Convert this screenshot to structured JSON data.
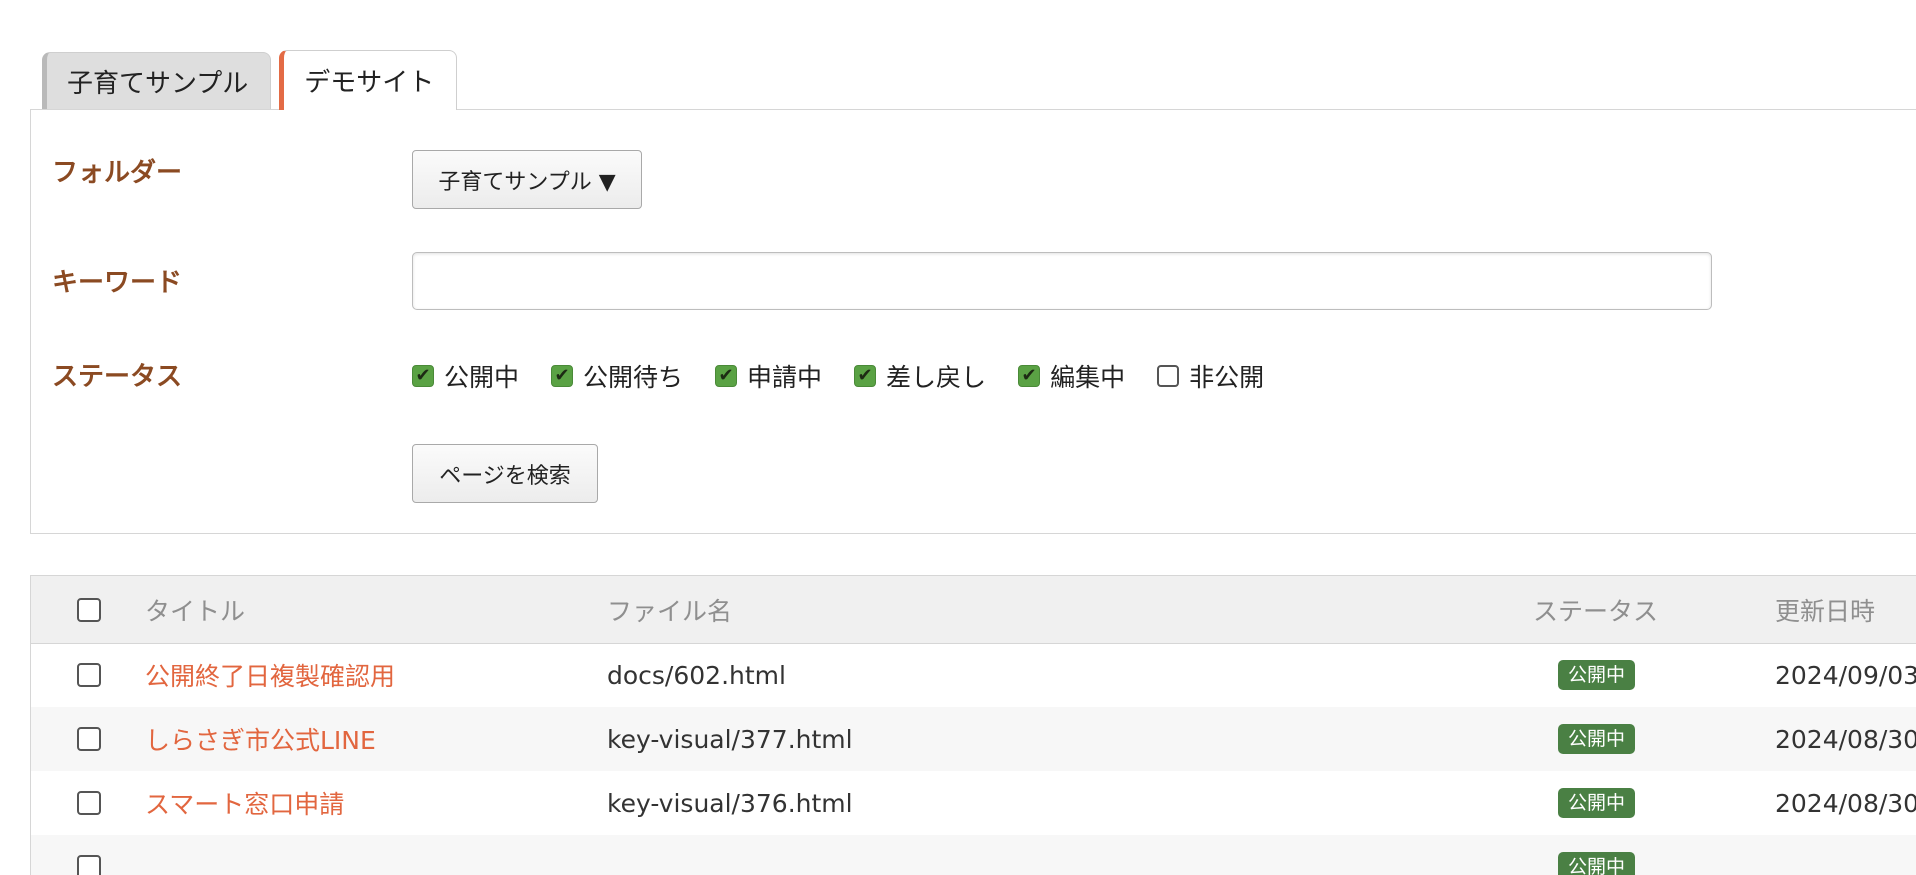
{
  "tabs": [
    {
      "label": "子育てサンプル",
      "active": false
    },
    {
      "label": "デモサイト",
      "active": true
    }
  ],
  "search": {
    "folder_label": "フォルダー",
    "folder_value": "子育てサンプル ▼",
    "keyword_label": "キーワード",
    "keyword_value": "",
    "keyword_placeholder": "",
    "status_label": "ステータス",
    "statuses": [
      {
        "label": "公開中",
        "checked": true
      },
      {
        "label": "公開待ち",
        "checked": true
      },
      {
        "label": "申請中",
        "checked": true
      },
      {
        "label": "差し戻し",
        "checked": true
      },
      {
        "label": "編集中",
        "checked": true
      },
      {
        "label": "非公開",
        "checked": false
      }
    ],
    "search_button": "ページを検索"
  },
  "table": {
    "headers": {
      "title": "タイトル",
      "filename": "ファイル名",
      "status": "ステータス",
      "updated": "更新日時"
    },
    "rows": [
      {
        "title": "公開終了日複製確認用",
        "filename": "docs/602.html",
        "status": "公開中",
        "updated": "2024/09/03"
      },
      {
        "title": "しらさぎ市公式LINE",
        "filename": "key-visual/377.html",
        "status": "公開中",
        "updated": "2024/08/30"
      },
      {
        "title": "スマート窓口申請",
        "filename": "key-visual/376.html",
        "status": "公開中",
        "updated": "2024/08/30"
      },
      {
        "title": "",
        "filename": "",
        "status": "公開中",
        "updated": ""
      }
    ]
  },
  "colors": {
    "accent": "#e36b45",
    "label_brown": "#8b4a22",
    "checkbox_green": "#5aa244",
    "badge_green": "#4a8044",
    "link_orange": "#e2663f"
  }
}
